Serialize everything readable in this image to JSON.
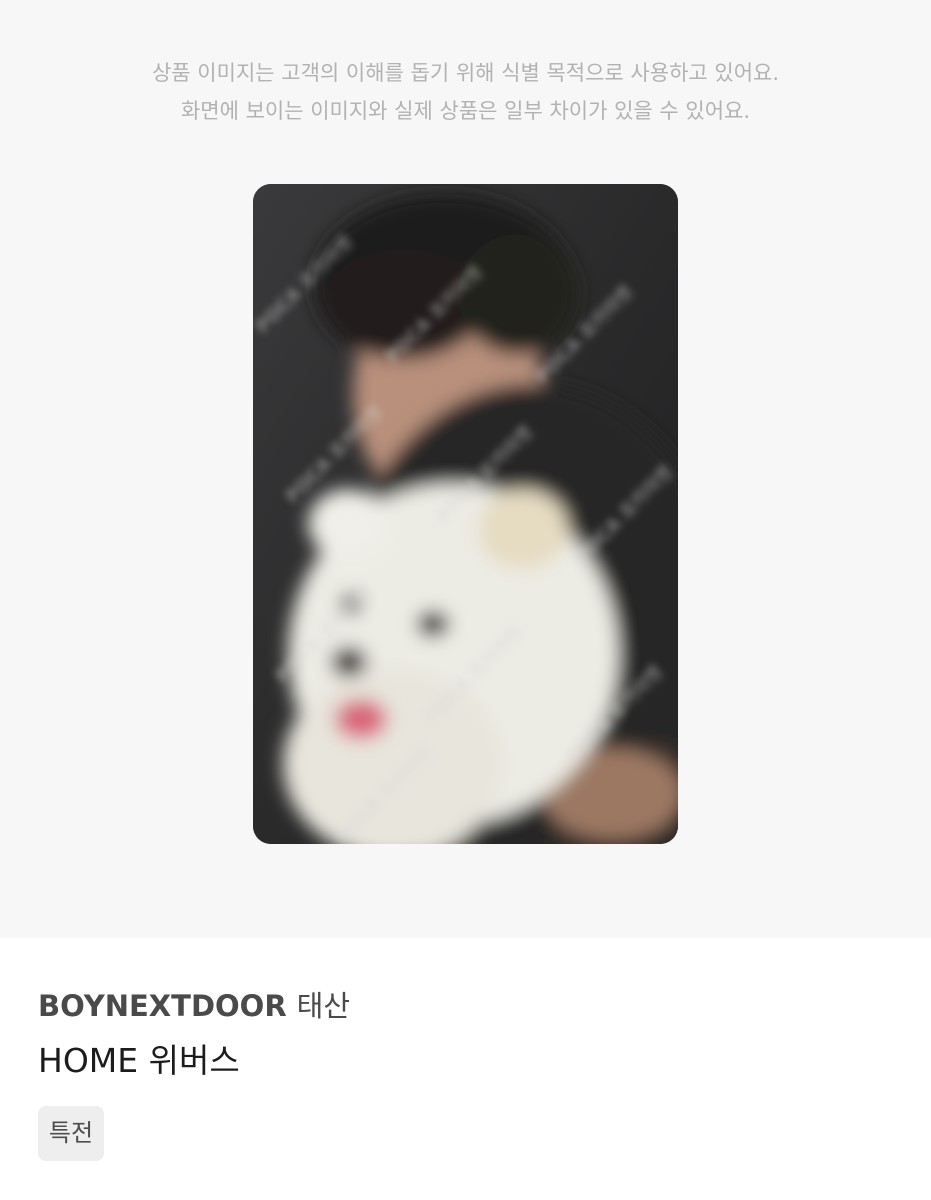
{
  "notice": {
    "line1": "상품 이미지는 고객의 이해를 돕기 위해 식별 목적으로 사용하고 있어요.",
    "line2": "화면에 보이는 이미지와 실제 상품은 일부 차이가 있을 수 있어요."
  },
  "product_image": {
    "watermark": "POCA 포카마켓"
  },
  "product": {
    "artist": "BOYNEXTDOOR",
    "member": "태산",
    "title": "HOME 위버스",
    "tag": "특전"
  },
  "colors": {
    "hero_background": "#f7f7f7",
    "notice_text": "#b2b2b2",
    "tag_background": "#eeeeee"
  }
}
